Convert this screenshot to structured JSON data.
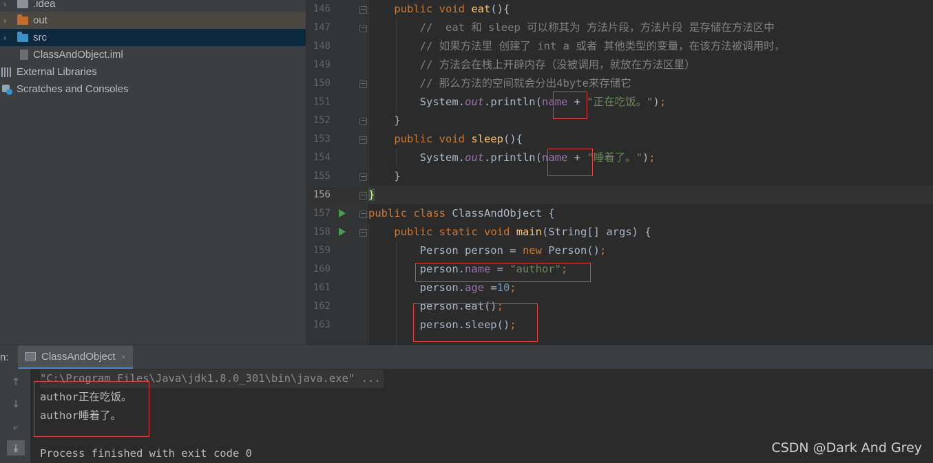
{
  "project_tree": {
    "items": [
      {
        "label": ".idea"
      },
      {
        "label": "out"
      },
      {
        "label": "src"
      },
      {
        "label": "ClassAndObject.iml"
      },
      {
        "label": "External Libraries"
      },
      {
        "label": "Scratches and Consoles"
      }
    ]
  },
  "editor": {
    "line_numbers": [
      "146",
      "147",
      "148",
      "149",
      "150",
      "151",
      "152",
      "153",
      "154",
      "155",
      "156",
      "157",
      "158",
      "159",
      "160",
      "161",
      "162",
      "163"
    ],
    "current_line": "156",
    "code": {
      "l146": {
        "indent": "    ",
        "kw1": "public",
        "kw2": "void",
        "fn": "eat",
        "rest": "(){"
      },
      "l147": {
        "indent": "        ",
        "comment": "//  eat 和 sleep 可以称其为 方法片段，方法片段 是存储在方法区中"
      },
      "l148": {
        "indent": "        ",
        "comment": "// 如果方法里 创建了 int a 或者 其他类型的变量，在该方法被调用时，"
      },
      "l149": {
        "indent": "        ",
        "comment": "// 方法会在栈上开辟内存（没被调用，就放在方法区里）"
      },
      "l150": {
        "indent": "        ",
        "comment": "// 那么方法的空间就会分出4byte来存储它"
      },
      "l151": {
        "indent": "        ",
        "obj": "System.",
        "sfield": "out",
        "call": ".println(",
        "field": "name",
        "op": " + ",
        "str": "\"正在吃饭。\"",
        "close": ")",
        "semi": ";"
      },
      "l152": {
        "indent": "    ",
        "text": "}"
      },
      "l153": {
        "indent": "    ",
        "kw1": "public",
        "kw2": "void",
        "fn": "sleep",
        "rest": "(){"
      },
      "l154": {
        "indent": "        ",
        "obj": "System.",
        "sfield": "out",
        "call": ".println(",
        "field": "name",
        "op": " + ",
        "str": "\"睡着了。\"",
        "close": ")",
        "semi": ";"
      },
      "l155": {
        "indent": "    ",
        "text": "}"
      },
      "l156": {
        "brace": "}"
      },
      "l157": {
        "kw1": "public",
        "kw2": "class",
        "name": "ClassAndObject",
        "rest": " {"
      },
      "l158": {
        "indent": "    ",
        "kw1": "public",
        "kw2": "static",
        "kw3": "void",
        "fn": "main",
        "rest": "(String[] args) {"
      },
      "l159": {
        "indent": "        ",
        "text1": "Person person = ",
        "kw": "new",
        "text2": " Person()",
        "semi": ";"
      },
      "l160": {
        "indent": "        ",
        "obj": "person.",
        "field": "name",
        "op": " = ",
        "str": "\"author\"",
        "semi": ";"
      },
      "l161": {
        "indent": "        ",
        "obj": "person.",
        "field": "age",
        "op": " =",
        "num": "10",
        "semi": ";"
      },
      "l162": {
        "indent": "        ",
        "text": "person.eat()",
        "semi": ";"
      },
      "l163": {
        "indent": "        ",
        "text": "person.sleep()",
        "semi": ";"
      }
    }
  },
  "run_panel": {
    "label": "n:",
    "tab_label": "ClassAndObject",
    "tab_close": "×",
    "console_lines": [
      "\"C:\\Program Files\\Java\\jdk1.8.0_301\\bin\\java.exe\" ...",
      "author正在吃饭。",
      "author睡着了。",
      "",
      "Process finished with exit code 0"
    ]
  },
  "watermark": "CSDN @Dark And Grey",
  "colors": {
    "keyword": "#cc7832",
    "function": "#ffc66d",
    "field": "#9876aa",
    "string": "#6a8759",
    "number": "#6897bb",
    "comment": "#808080",
    "highlight_box": "#e04040",
    "run_icon": "#499c54"
  }
}
